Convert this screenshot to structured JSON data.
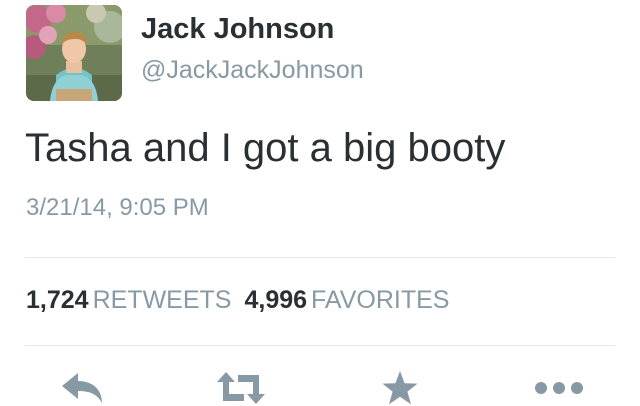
{
  "tweet": {
    "author": {
      "display_name": "Jack Johnson",
      "handle": "@JackJackJohnson"
    },
    "text": "Tasha and I got a big booty",
    "timestamp": "3/21/14, 9:05 PM",
    "stats": {
      "retweets_count": "1,724",
      "retweets_label": "RETWEETS",
      "favorites_count": "4,996",
      "favorites_label": "FAVORITES"
    }
  },
  "icons": {
    "reply": "reply-icon",
    "retweet": "retweet-icon",
    "favorite": "star-icon",
    "more": "more-icon"
  },
  "colors": {
    "text": "#292f33",
    "secondary_text": "#8899a6",
    "divider": "#e1e8ed",
    "action_icon": "#8899a6"
  }
}
